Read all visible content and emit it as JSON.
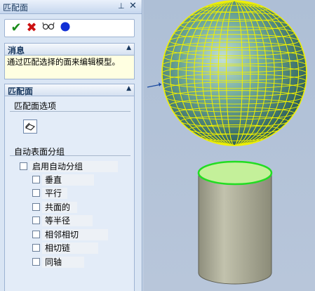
{
  "panel": {
    "title": "匹配面",
    "pin_icon": "pin-icon",
    "close_icon": "close-icon"
  },
  "actions": {
    "ok_icon": "checkmark-icon",
    "cancel_icon": "x-icon",
    "preview_icon": "glasses-icon",
    "detail_icon": "blue-dot-icon"
  },
  "message": {
    "header": "消息",
    "text": "通过匹配选择的面来编辑模型。"
  },
  "match_faces": {
    "header": "匹配面",
    "options_label": "匹配面选项",
    "auto_group_label": "自动表面分组",
    "enable_auto_group": "启用自动分组",
    "items": [
      "垂直",
      "平行",
      "共面的",
      "等半径",
      "相邻相切",
      "相切链",
      "同轴"
    ]
  },
  "colors": {
    "panel_bg": "#d9e5f4",
    "mesh": "#f0f000",
    "sphere": "#5f9b8c",
    "cylinder": "#b1b199",
    "highlight_edge": "#22dd22"
  }
}
